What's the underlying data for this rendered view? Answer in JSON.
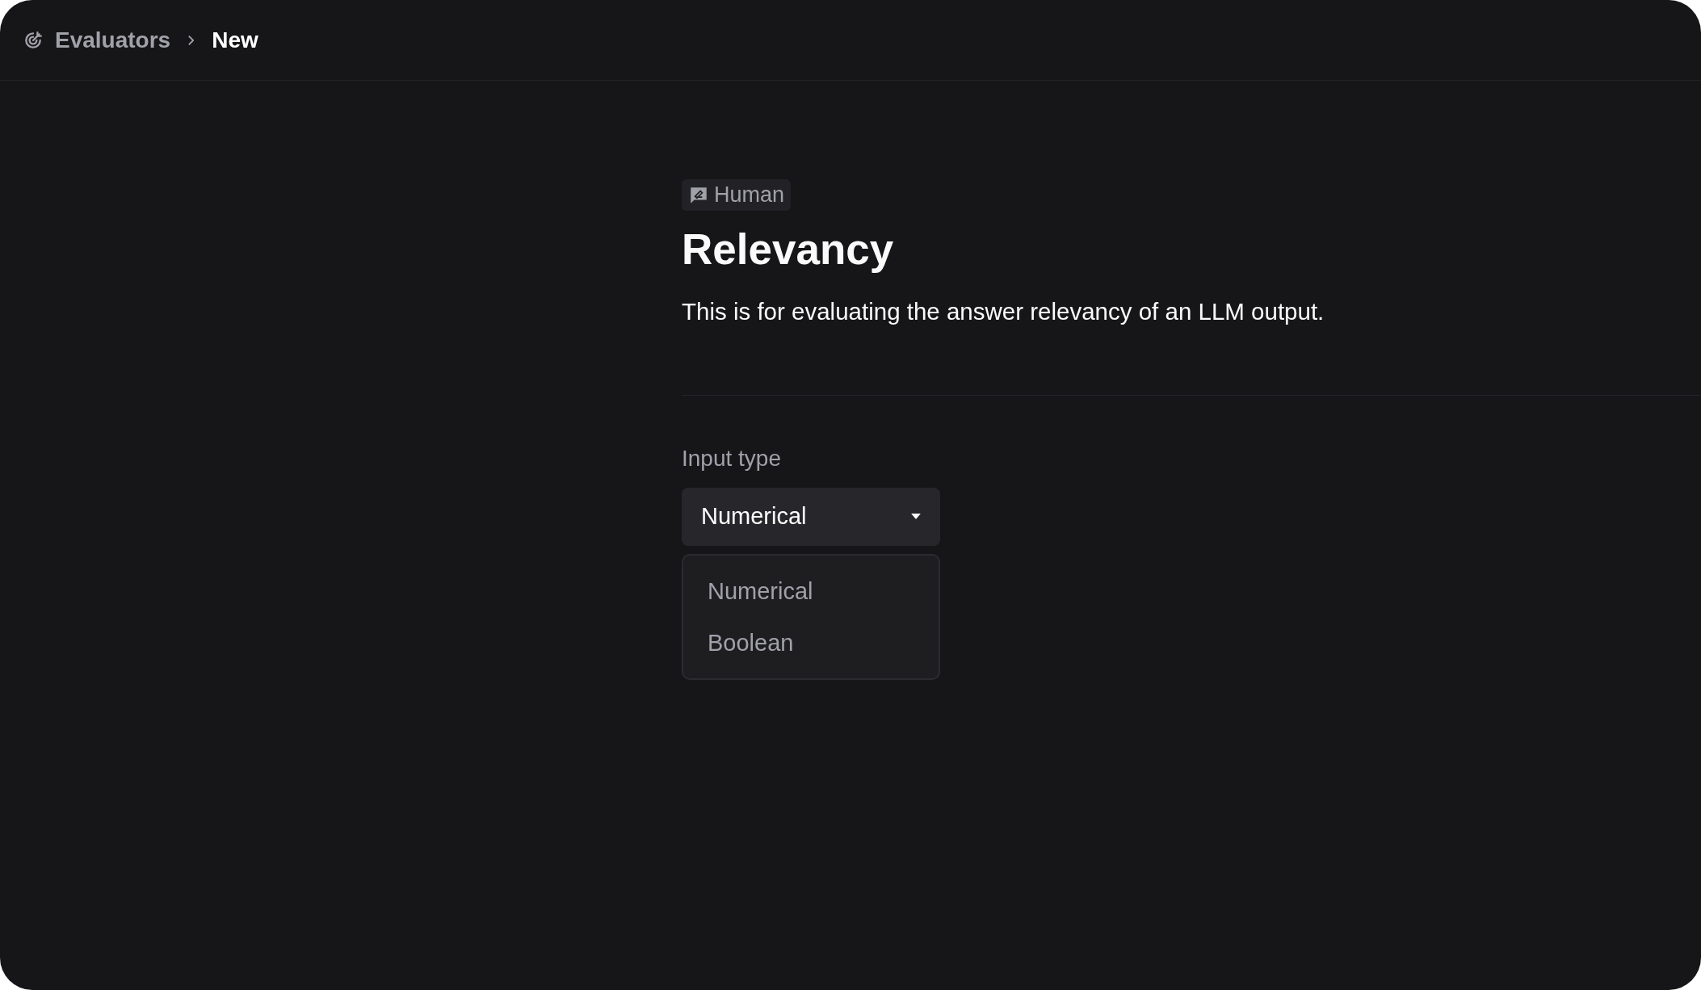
{
  "breadcrumb": [
    {
      "label": "Evaluators",
      "current": false
    },
    {
      "label": "New",
      "current": true
    }
  ],
  "badge": {
    "label": "Human"
  },
  "title": "Relevancy",
  "description": "This is for evaluating the answer relevancy of an LLM output.",
  "field": {
    "label": "Input type",
    "value": "Numerical",
    "options": [
      {
        "label": "Numerical"
      },
      {
        "label": "Boolean"
      }
    ]
  }
}
